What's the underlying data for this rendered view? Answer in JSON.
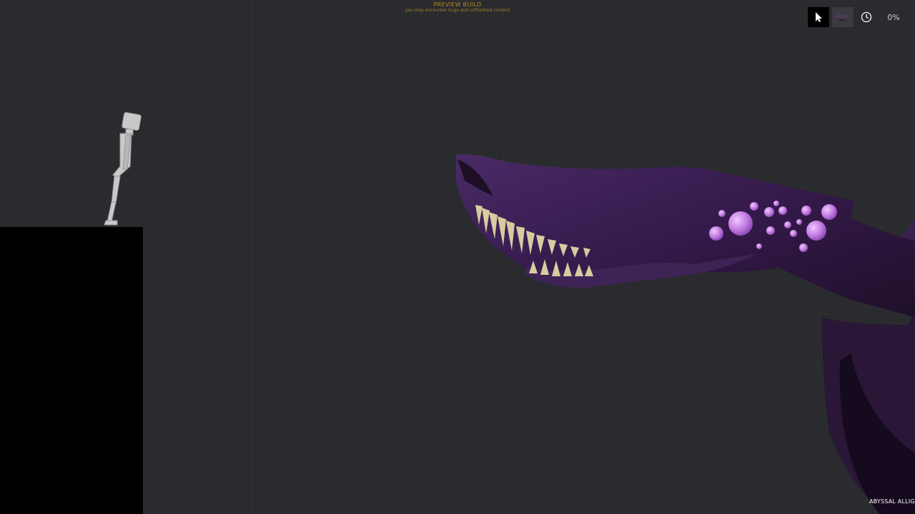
{
  "banner": {
    "title": "PREVIEW BUILD",
    "subtitle": "you may encounter bugs and unfinished content"
  },
  "toolbar": {
    "pointer_icon": "cursor-icon",
    "selected_item_thumbnail": "creature-thumbnail-icon",
    "time_icon": "clock-icon",
    "time_scale_label": "0%"
  },
  "hud": {
    "item_label": "ABYSSAL ALLIG"
  },
  "colors": {
    "background": "#2a2b2e",
    "platform": "#000000",
    "creature_body": "#3a2150",
    "creature_eyes": "#c98ae6",
    "teeth": "#d8cba0",
    "ragdoll": "#c8c8c8",
    "banner_text": "#b08a2a"
  }
}
